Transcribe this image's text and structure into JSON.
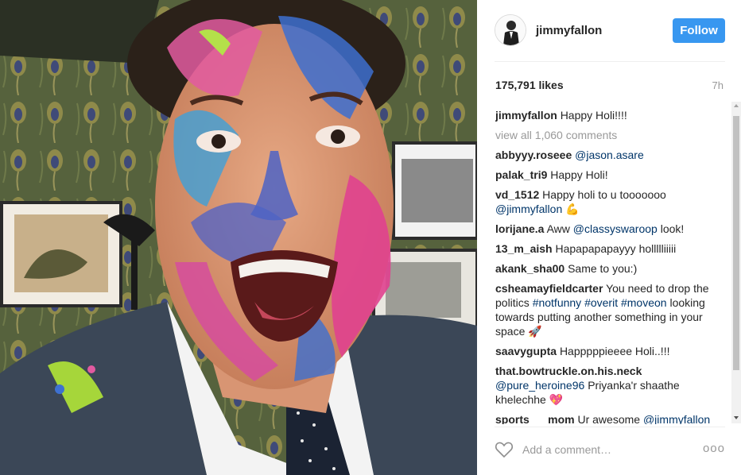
{
  "post": {
    "username": "jimmyfallon",
    "follow_label": "Follow",
    "likes": "175,791 likes",
    "time": "7h",
    "caption_user": "jimmyfallon",
    "caption_text": "Happy Holi!!!!",
    "view_all": "view all 1,060 comments",
    "add_comment_placeholder": "Add a comment…",
    "more_label": "ooo"
  },
  "comments": [
    {
      "user": "abbyyy.roseee",
      "mention": "@jason.asare",
      "text": ""
    },
    {
      "user": "palak_tri9",
      "text": "Happy Holi!"
    },
    {
      "user": "vd_1512",
      "text": "Happy holi to u tooooooo",
      "mention2": "@jimmyfallon",
      "emoji": "💪"
    },
    {
      "user": "lorijane.a",
      "text": "Aww",
      "mention": "@classyswaroop",
      "text2": "look!"
    },
    {
      "user": "13_m_aish",
      "text": "Hapapapapayyy hollllliiiii"
    },
    {
      "user": "akank_sha00",
      "text": "Same to you:)"
    },
    {
      "user": "csheamayfieldcarter",
      "text": "You need to drop the politics",
      "tags": "#notfunny #overit #moveon",
      "text2": "looking towards putting another something in your space",
      "emoji": "🚀"
    },
    {
      "user": "saavygupta",
      "text": "Happpppieeee Holi..!!!"
    },
    {
      "user": "that.bowtruckle.on.his.neck",
      "mention": "@pure_heroine96",
      "text": "Priyanka'r shaathe khelechhe",
      "emoji": "💖"
    },
    {
      "user": "sports___mom",
      "text": "Ur awesome",
      "mention2": "@jimmyfallon"
    }
  ],
  "colors": {
    "follow_bg": "#3897f0",
    "link": "#003569",
    "muted": "#999999"
  },
  "icons": {
    "heart": "heart-icon",
    "more": "more-options-icon"
  }
}
